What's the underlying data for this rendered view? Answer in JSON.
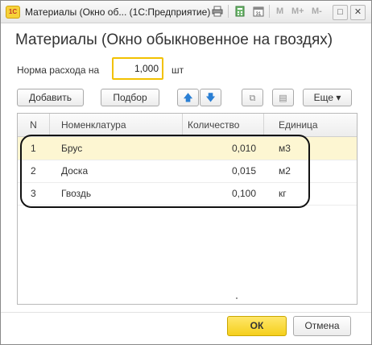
{
  "window": {
    "logo_text": "1С",
    "title": "Материалы (Окно об...  (1С:Предприятие)",
    "toolbar": {
      "icons": [
        "printer-icon",
        "calculator-icon",
        "calendar-icon"
      ],
      "m_label": "M",
      "m_plus_label": "M+",
      "m_minus_label": "M-"
    },
    "minimize": "–",
    "maximize": "□",
    "close": "✕"
  },
  "form": {
    "title": "Материалы (Окно обыкновенное на гвоздях)",
    "norm": {
      "label": "Норма расхода на",
      "value": "1,000",
      "unit": "шт"
    }
  },
  "toolbar": {
    "add_label": "Добавить",
    "pick_label": "Подбор",
    "move_up": "🡅",
    "move_down": "🡇",
    "copy_icon": "⧉",
    "paste_icon": "▤",
    "more_label": "Еще ▾"
  },
  "table": {
    "columns": [
      "N",
      "Номенклатура",
      "Количество",
      "Единица"
    ],
    "rows": [
      {
        "n": "1",
        "item": "Брус",
        "qty": "0,010",
        "unit": "м3"
      },
      {
        "n": "2",
        "item": "Доска",
        "qty": "0,015",
        "unit": "м2"
      },
      {
        "n": "3",
        "item": "Гвоздь",
        "qty": "0,100",
        "unit": "кг"
      }
    ],
    "selected_row": 1
  },
  "footer": {
    "ok_label": "ОК",
    "cancel_label": "Отмена"
  },
  "colors": {
    "accent": "#f5cf1c",
    "selection": "#fdf6d2",
    "arrow": "#2a7fd4"
  }
}
